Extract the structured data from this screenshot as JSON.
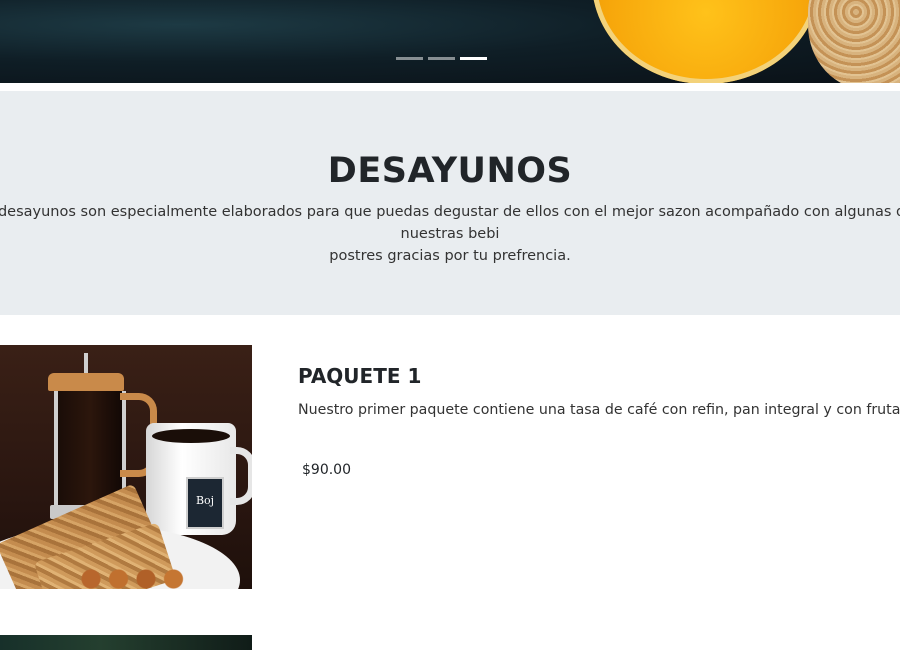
{
  "hero": {
    "indicators": [
      {
        "active": false
      },
      {
        "active": false
      },
      {
        "active": true
      }
    ]
  },
  "intro": {
    "title": "DESAYUNOS",
    "line1": "s desayunos son especialmente elaborados para que puedas degustar de ellos con el mejor sazon acompañado con algunas de nuestras bebi",
    "line2": "postres gracias por tu prefrencia."
  },
  "packages": [
    {
      "title": "PAQUETE 1",
      "description": "Nuestro primer paquete contiene una tasa de café con refin, pan integral y con fruta de tempo",
      "price": "$90.00",
      "mug_logo": "Boj"
    }
  ],
  "colors": {
    "intro_bg": "#e9edf0",
    "text": "#212529"
  }
}
